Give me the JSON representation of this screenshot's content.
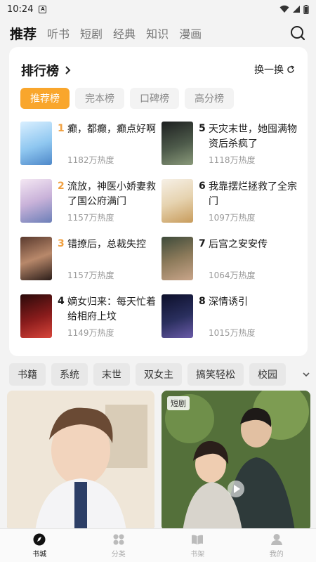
{
  "status": {
    "time": "10:24",
    "sim_glyph": "A"
  },
  "top_tabs": [
    {
      "label": "推荐",
      "active": true
    },
    {
      "label": "听书"
    },
    {
      "label": "短剧"
    },
    {
      "label": "经典"
    },
    {
      "label": "知识"
    },
    {
      "label": "漫画"
    }
  ],
  "rank": {
    "title": "排行榜",
    "refresh_label": "换一换",
    "tabs": [
      "推荐榜",
      "完本榜",
      "口碑榜",
      "高分榜"
    ],
    "books": [
      {
        "num": "1",
        "title": "癫，都癫，癫点好啊",
        "heat": "1182万热度"
      },
      {
        "num": "2",
        "title": "流放，神医小娇妻救了国公府满门",
        "heat": "1157万热度"
      },
      {
        "num": "3",
        "title": "错撩后，总裁失控",
        "heat": "1157万热度"
      },
      {
        "num": "4",
        "title": "嫡女归来：每天忙着给相府上坟",
        "heat": "1149万热度"
      },
      {
        "num": "5",
        "title": "天灾末世，她囤满物资后杀疯了",
        "heat": "1118万热度"
      },
      {
        "num": "6",
        "title": "我靠摆烂拯救了全宗门",
        "heat": "1097万热度"
      },
      {
        "num": "7",
        "title": "后宫之安安传",
        "heat": "1064万热度"
      },
      {
        "num": "8",
        "title": "深情诱引",
        "heat": "1015万热度"
      }
    ]
  },
  "chips": [
    "书籍",
    "系统",
    "末世",
    "双女主",
    "搞笑轻松",
    "校园"
  ],
  "feed": {
    "badge": "短剧"
  },
  "tabbar": [
    {
      "label": "书城",
      "active": true
    },
    {
      "label": "分类"
    },
    {
      "label": "书架"
    },
    {
      "label": "我的"
    }
  ]
}
